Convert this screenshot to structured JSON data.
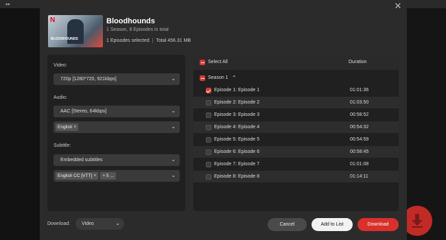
{
  "show": {
    "title": "Bloodhounds",
    "subtitle": "1 Season, 8 Episodes in total",
    "selected": "1 Episodes selected",
    "separator": "|",
    "total": "Total 456.31 MB",
    "poster_caption": "BLOODHOUNDS"
  },
  "left": {
    "video_label": "Video:",
    "video_value": "720p [1280*720, 921kbps]",
    "audio_label": "Audio:",
    "audio_value": "AAC [Stereo, 64kbps]",
    "audio_lang_chip": "English",
    "subtitle_label": "Subtitle:",
    "subtitle_value": "Embedded subtitles",
    "subtitle_chip": "English CC  [VTT]",
    "subtitle_more": "+ 5 ..."
  },
  "list": {
    "select_all": "Select All",
    "duration_header": "Duration",
    "season": "Season 1",
    "episodes": [
      {
        "name": "Episode 1: Episode 1",
        "duration": "01:01:36",
        "checked": true
      },
      {
        "name": "Episode 2: Episode 2",
        "duration": "01:03:50",
        "checked": false
      },
      {
        "name": "Episode 3: Episode 3",
        "duration": "00:58:52",
        "checked": false
      },
      {
        "name": "Episode 4: Episode 4",
        "duration": "00:54:32",
        "checked": false
      },
      {
        "name": "Episode 5: Episode 5",
        "duration": "00:54:59",
        "checked": false
      },
      {
        "name": "Episode 6: Episode 6",
        "duration": "00:58:45",
        "checked": false
      },
      {
        "name": "Episode 7: Episode 7",
        "duration": "01:01:08",
        "checked": false
      },
      {
        "name": "Episode 8: Episode 8",
        "duration": "01:14:11",
        "checked": false
      }
    ]
  },
  "bottom": {
    "download_label": "Download:",
    "download_type": "Video",
    "cancel": "Cancel",
    "add_to_list": "Add to List",
    "download": "Download"
  },
  "icons": {
    "close": "close-icon",
    "chevron": "chevron-down-icon",
    "download_fab": "download-arrow-icon"
  },
  "colors": {
    "accent": "#d9302b",
    "panel": "#202020",
    "dialog": "#2b2b2b"
  }
}
